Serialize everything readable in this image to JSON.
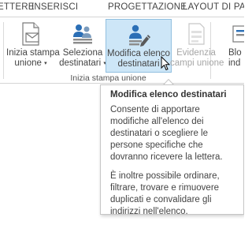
{
  "tabs": [
    {
      "label": "ETTERE"
    },
    {
      "label": "INSERISCI"
    },
    {
      "label": "PROGETTAZIONE"
    },
    {
      "label": "LAYOUT DI PAGINA"
    }
  ],
  "ribbon": {
    "group_label": "Inizia stampa unione",
    "buttons": [
      {
        "lines": [
          "Inizia stampa",
          "unione"
        ],
        "dropdown": true,
        "icon": "document-mail-merge-icon"
      },
      {
        "lines": [
          "Seleziona",
          "destinatari"
        ],
        "dropdown": true,
        "icon": "recipients-icon"
      },
      {
        "lines": [
          "Modifica elenco",
          "destinatari"
        ],
        "dropdown": false,
        "icon": "edit-recipient-list-icon",
        "state": "hovered"
      },
      {
        "lines": [
          "Evidenzia",
          "campi unione"
        ],
        "dropdown": false,
        "icon": "highlight-fields-icon",
        "state": "disabled"
      },
      {
        "lines": [
          "Blo",
          "ind"
        ],
        "dropdown": false,
        "icon": "address-block-icon",
        "state": "partial"
      }
    ]
  },
  "tooltip": {
    "title": "Modifica elenco destinatari",
    "paragraphs": [
      [
        "Consente di apportare",
        "modifiche all'elenco dei",
        "destinatari o scegliere le",
        "persone specifiche che",
        "dovranno ricevere la lettera."
      ],
      [
        "È inoltre possibile ordinare,",
        "filtrare, trovare e rimuovere",
        "duplicati e convalidare gli",
        "indirizzi nell'elenco."
      ]
    ]
  },
  "colors": {
    "hover_fill": "#cde6f7",
    "hover_border": "#92c0e0",
    "icon_blue": "#2b6fb6",
    "disabled_text": "#a6a6a6"
  }
}
